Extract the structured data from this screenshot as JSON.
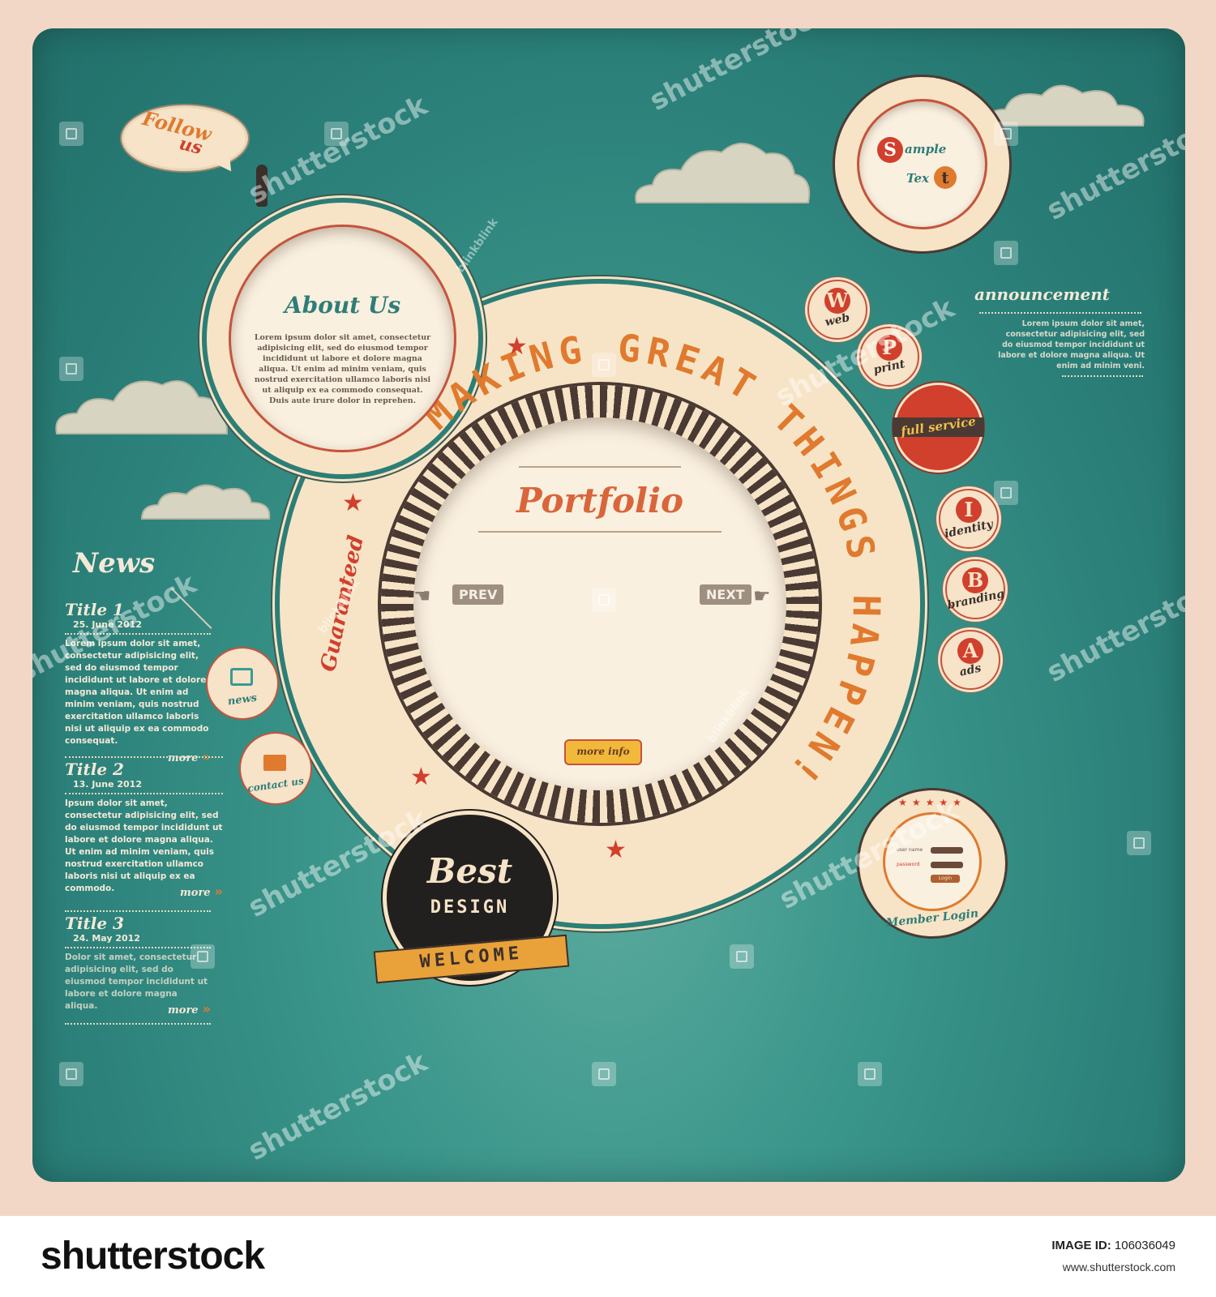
{
  "follow": {
    "line1": "Follow",
    "line2": "us"
  },
  "about": {
    "title": "About Us",
    "body": "Lorem ipsum dolor sit amet, consectetur adipisicing elit, sed do eiusmod tempor incididunt ut labore et dolore magna aliqua. Ut enim ad minim veniam, quis nostrud exercitation ullamco laboris nisi ut aliquip ex ea commodo consequat. Duis aute irure dolor in reprehen."
  },
  "ring_text": "MAKING GREAT THINGS HAPPEN!",
  "guaranteed": "Guaranteed",
  "portfolio": {
    "title": "Portfolio",
    "prev": "PREV",
    "next": "NEXT",
    "more_info": "more info"
  },
  "best": {
    "line1": "Best",
    "line2": "DESIGN",
    "ribbon": "WELCOME"
  },
  "sample": {
    "letter1": "S",
    "text1": "ample",
    "text2": "Tex",
    "letter2": "t"
  },
  "services": [
    {
      "letter": "W",
      "label": "web"
    },
    {
      "letter": "P",
      "label": "print"
    },
    {
      "letter": "",
      "label": "full service"
    },
    {
      "letter": "I",
      "label": "identity"
    },
    {
      "letter": "B",
      "label": "branding"
    },
    {
      "letter": "A",
      "label": "ads"
    }
  ],
  "announcement": {
    "title": "announcement",
    "body": "Lorem ipsum dolor sit amet, consectetur adipisicing elit, sed do eiusmod tempor incididunt ut labore et dolore magna aliqua. Ut enim ad minim veni."
  },
  "news": {
    "title": "News",
    "more": "more",
    "items": [
      {
        "title": "Title 1",
        "date": "25. June 2012",
        "body": "Lorem ipsum dolor sit amet, consectetur adipisicing elit, sed do eiusmod tempor incididunt ut labore et dolore magna aliqua. Ut enim ad minim veniam, quis nostrud exercitation ullamco laboris nisi ut aliquip ex ea commodo consequat."
      },
      {
        "title": "Title 2",
        "date": "13. June 2012",
        "body": "Ipsum dolor sit amet, consectetur adipisicing elit, sed do eiusmod tempor incididunt ut labore et dolore magna aliqua. Ut enim ad minim veniam, quis nostrud exercitation ullamco laboris nisi ut aliquip ex ea commodo."
      },
      {
        "title": "Title 3",
        "date": "24. May 2012",
        "body": "Dolor sit amet, consectetur adipisicing elit, sed do eiusmod tempor incididunt ut labore et dolore magna aliqua."
      }
    ]
  },
  "news_badge": "news",
  "contact_badge": "contact us",
  "login": {
    "user_label": "user name",
    "password_label": "password",
    "button": "Login",
    "caption": "Member Login"
  },
  "watermarks": {
    "brand": "shutterstock",
    "blink": "blinkblink"
  },
  "footer": {
    "logo": "shutterstock",
    "image_id_label": "IMAGE ID:",
    "image_id": "106036049",
    "site": "www.shutterstock.com"
  },
  "colors": {
    "teal": "#2f8a82",
    "cream": "#f6e3c8",
    "orange": "#e07a2e",
    "red": "#d13f2d",
    "brown": "#4a3a33"
  }
}
